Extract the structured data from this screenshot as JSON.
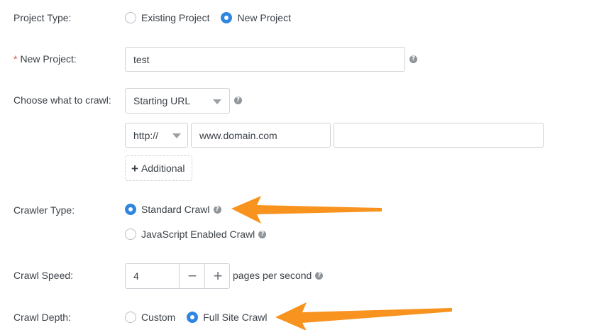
{
  "project_type": {
    "label": "Project Type:",
    "options": [
      "Existing Project",
      "New Project"
    ],
    "selected": "New Project"
  },
  "new_project": {
    "required_mark": "*",
    "label": "New Project:",
    "value": "test",
    "help_icon": "question-circle-icon"
  },
  "crawl_source": {
    "label": "Choose what to crawl:",
    "select_value": "Starting URL",
    "protocol_value": "http://",
    "domain_value": "www.domain.com",
    "path_value": "",
    "additional_label": "Additional",
    "additional_icon": "plus-icon"
  },
  "crawler_type": {
    "label": "Crawler Type:",
    "options": [
      "Standard Crawl",
      "JavaScript Enabled Crawl"
    ],
    "selected": "Standard Crawl"
  },
  "crawl_speed": {
    "label": "Crawl Speed:",
    "value": "4",
    "minus": "−",
    "plus": "+",
    "unit": "pages per second"
  },
  "crawl_depth": {
    "label": "Crawl Depth:",
    "options": [
      "Custom",
      "Full Site Crawl"
    ],
    "selected": "Full Site Crawl"
  },
  "colors": {
    "accent": "#2f86e0",
    "arrow": "#f7931e",
    "required": "#d9534f"
  }
}
